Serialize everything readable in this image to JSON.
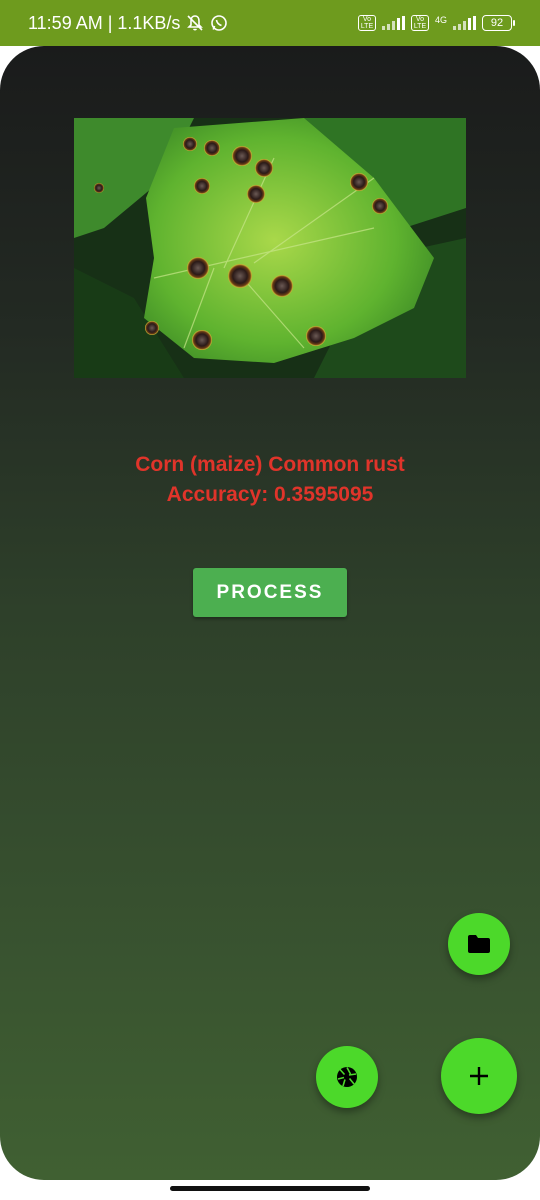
{
  "status_bar": {
    "time_speed": "11:59 AM | 1.1KB/s",
    "volte_1": "Vo LTE",
    "volte_2": "Vo LTE",
    "network": "4G",
    "battery": "92",
    "icons": [
      "mute-bell-icon",
      "whatsapp-icon",
      "signal-icon",
      "battery-icon"
    ]
  },
  "main": {
    "result_label": "Corn (maize) Common rust",
    "accuracy_text": "Accuracy: 0.3595095",
    "process_button": "PROCESS"
  },
  "fabs": {
    "folder_icon": "folder-icon",
    "camera_icon": "camera-aperture-icon",
    "add_icon": "plus-icon"
  },
  "colors": {
    "status_bar": "#6e9b1e",
    "result_text": "#e0342a",
    "process_button": "#4caf50",
    "fab": "#4cd92a"
  }
}
